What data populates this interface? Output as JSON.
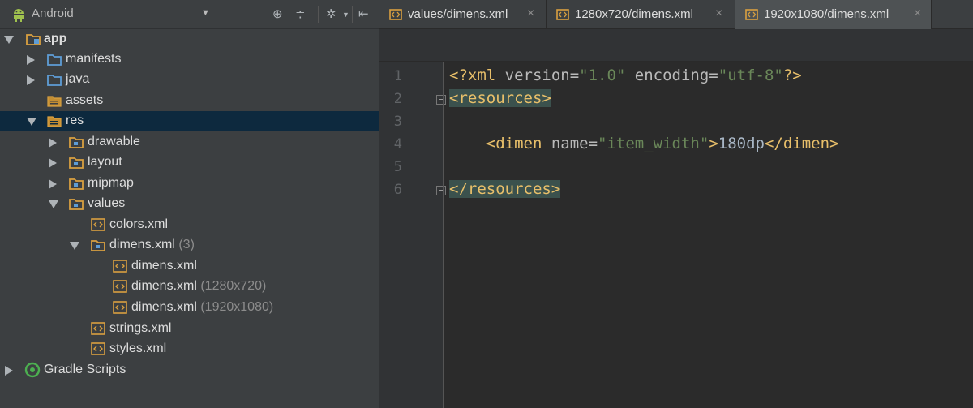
{
  "project_pane": {
    "view_label": "Android",
    "tree": [
      {
        "label": "app",
        "suffix": "",
        "bold": true
      },
      {
        "label": "manifests",
        "suffix": ""
      },
      {
        "label": "java",
        "suffix": ""
      },
      {
        "label": "assets",
        "suffix": ""
      },
      {
        "label": "res",
        "suffix": ""
      },
      {
        "label": "drawable",
        "suffix": ""
      },
      {
        "label": "layout",
        "suffix": ""
      },
      {
        "label": "mipmap",
        "suffix": ""
      },
      {
        "label": "values",
        "suffix": ""
      },
      {
        "label": "colors.xml",
        "suffix": ""
      },
      {
        "label": "dimens.xml",
        "suffix": " (3)"
      },
      {
        "label": "dimens.xml",
        "suffix": ""
      },
      {
        "label": "dimens.xml",
        "suffix": " (1280x720)"
      },
      {
        "label": "dimens.xml",
        "suffix": " (1920x1080)"
      },
      {
        "label": "strings.xml",
        "suffix": ""
      },
      {
        "label": "styles.xml",
        "suffix": ""
      },
      {
        "label": "Gradle Scripts",
        "suffix": ""
      }
    ]
  },
  "editor": {
    "tabs": [
      {
        "label": "values/dimens.xml",
        "close": "×"
      },
      {
        "label": "1280x720/dimens.xml",
        "close": "×"
      },
      {
        "label": "1920x1080/dimens.xml",
        "close": "×",
        "active": true
      }
    ],
    "line_numbers": [
      "1",
      "2",
      "3",
      "4",
      "5",
      "6"
    ],
    "code": {
      "l1": {
        "a": "<?xml",
        "b": " version=",
        "c": "\"1.0\"",
        "d": " encoding=",
        "e": "\"utf-8\"",
        "f": "?>"
      },
      "l2": {
        "a": "<resources>"
      },
      "l4": {
        "indent": "    ",
        "a": "<dimen",
        "b": " name=",
        "c": "\"item_width\"",
        "d": ">",
        "e": "180dp",
        "f": "</dimen>"
      },
      "l6": {
        "a": "</resources>"
      }
    }
  },
  "colors": {
    "tree_bg": "#3c3f41",
    "selection": "#0d293e",
    "editor_bg": "#2b2b2b",
    "xml_tag": "#e8bf6a",
    "xml_string": "#6a8759",
    "folder_blue": "#5e9dd6",
    "folder_orange": "#d9a040"
  }
}
